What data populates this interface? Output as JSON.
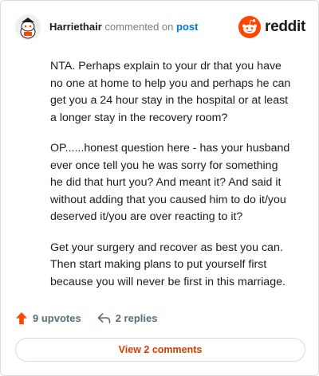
{
  "header": {
    "username": "Harriethair",
    "action_text": "commented on",
    "post_link": "post",
    "brand_name": "reddit"
  },
  "comment": {
    "paragraphs": [
      "NTA. Perhaps explain to your dr that you have no one at home to help you and perhaps he can get you a 24 hour stay in the hospital or at least a longer stay in the recovery room?",
      "OP......honest question here - has your husband ever once tell you he was sorry for something he did that hurt you? And meant it? And said it without adding that you caused him to do it/you deserved it/you are over reacting to it?",
      "Get your surgery and recover as best you can. Then start making plans to put yourself first because you will never be first in this marriage."
    ]
  },
  "actions": {
    "upvotes": "9 upvotes",
    "replies": "2 replies"
  },
  "footer": {
    "view_comments_label": "View 2 comments"
  },
  "colors": {
    "brand_orange": "#ff4500",
    "link_blue": "#0079d3",
    "button_text": "#d93a00",
    "muted_text": "#576f76"
  },
  "icons": {
    "avatar": "snoo-avatar-icon",
    "brand": "reddit-logo-icon",
    "upvote": "upvote-arrow-icon",
    "reply": "reply-arrow-icon"
  }
}
